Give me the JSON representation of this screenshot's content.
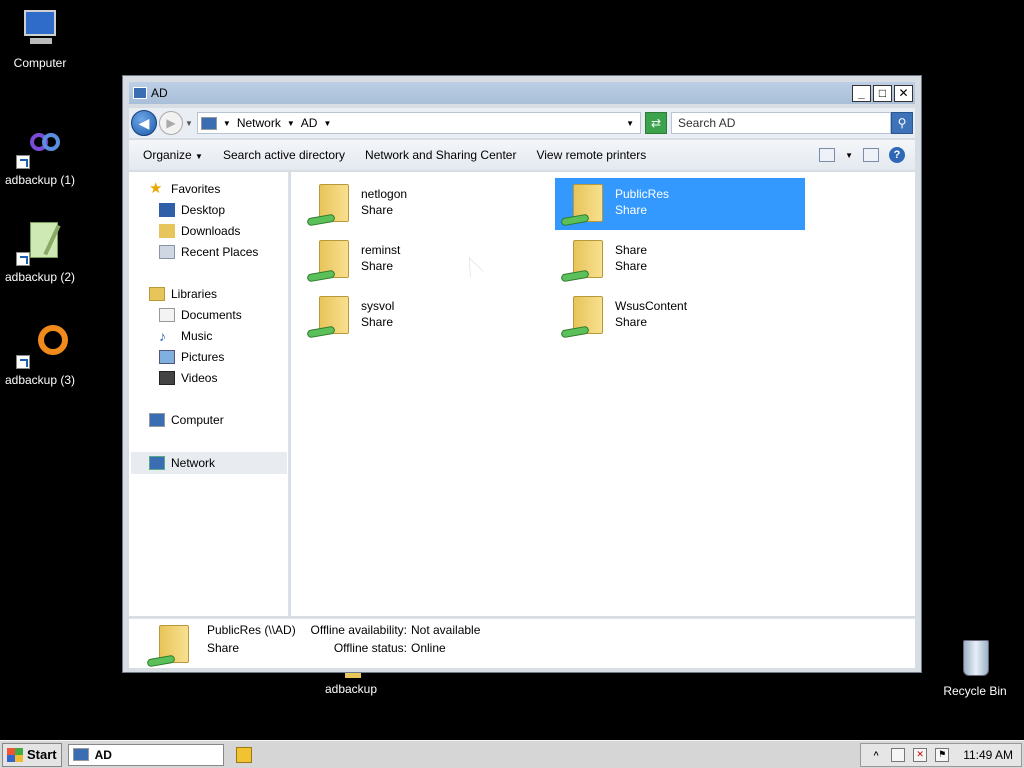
{
  "desktop": {
    "icons": [
      {
        "label": "Computer",
        "icon": "computer-icon"
      },
      {
        "label": "adbackup (1)",
        "icon": "infinity-app-icon"
      },
      {
        "label": "adbackup (2)",
        "icon": "notepad-app-icon"
      },
      {
        "label": "adbackup (3)",
        "icon": "ring-app-icon"
      },
      {
        "label": "adbackup",
        "icon": "folder-icon"
      },
      {
        "label": "Recycle Bin",
        "icon": "recycle-bin-icon"
      }
    ]
  },
  "window": {
    "title": "AD",
    "buttons": {
      "minimize": "_",
      "maximize": "□",
      "close": "✕"
    }
  },
  "address": {
    "crumbs": [
      "Network",
      "AD"
    ],
    "search_placeholder": "Search AD"
  },
  "toolbar": {
    "items": [
      "Organize",
      "Search active directory",
      "Network and Sharing Center",
      "View remote printers"
    ]
  },
  "navpane": {
    "favorites_label": "Favorites",
    "favorites": [
      "Desktop",
      "Downloads",
      "Recent Places"
    ],
    "libraries_label": "Libraries",
    "libraries": [
      "Documents",
      "Music",
      "Pictures",
      "Videos"
    ],
    "computer_label": "Computer",
    "network_label": "Network"
  },
  "shares": [
    {
      "name": "netlogon",
      "type": "Share",
      "selected": false
    },
    {
      "name": "PublicRes",
      "type": "Share",
      "selected": true
    },
    {
      "name": "reminst",
      "type": "Share",
      "selected": false
    },
    {
      "name": "Share",
      "type": "Share",
      "selected": false
    },
    {
      "name": "sysvol",
      "type": "Share",
      "selected": false
    },
    {
      "name": "WsusContent",
      "type": "Share",
      "selected": false
    }
  ],
  "details": {
    "name": "PublicRes (\\\\AD)",
    "type": "Share",
    "offline_availability_label": "Offline availability:",
    "offline_availability_value": "Not available",
    "offline_status_label": "Offline status:",
    "offline_status_value": "Online"
  },
  "taskbar": {
    "start_label": "Start",
    "task_label": "AD",
    "clock": "11:49 AM"
  },
  "colors": {
    "selection": "#3399ff",
    "desktop": "#000000"
  }
}
